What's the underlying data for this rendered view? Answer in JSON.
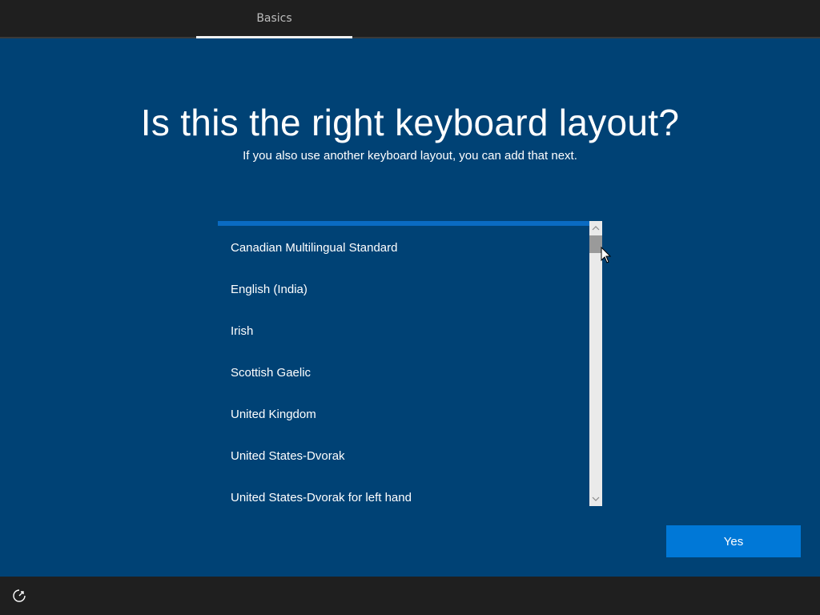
{
  "tabs": [
    {
      "label": "Basics"
    }
  ],
  "page": {
    "title": "Is this the right keyboard layout?",
    "subtitle": "If you also use another keyboard layout, you can add that next."
  },
  "keyboard_layouts": [
    "Canadian Multilingual Standard",
    "English (India)",
    "Irish",
    "Scottish Gaelic",
    "United Kingdom",
    "United States-Dvorak",
    "United States-Dvorak for left hand"
  ],
  "buttons": {
    "yes_label": "Yes"
  },
  "icons": {
    "scroll_up": "chevron-up-icon",
    "scroll_down": "chevron-down-icon",
    "accessibility": "ease-of-access-icon",
    "cursor": "mouse-pointer-icon"
  },
  "colors": {
    "background": "#004275",
    "bar": "#1f1f1f",
    "accent": "#0078d7",
    "selection_line": "#0a6bc2"
  }
}
